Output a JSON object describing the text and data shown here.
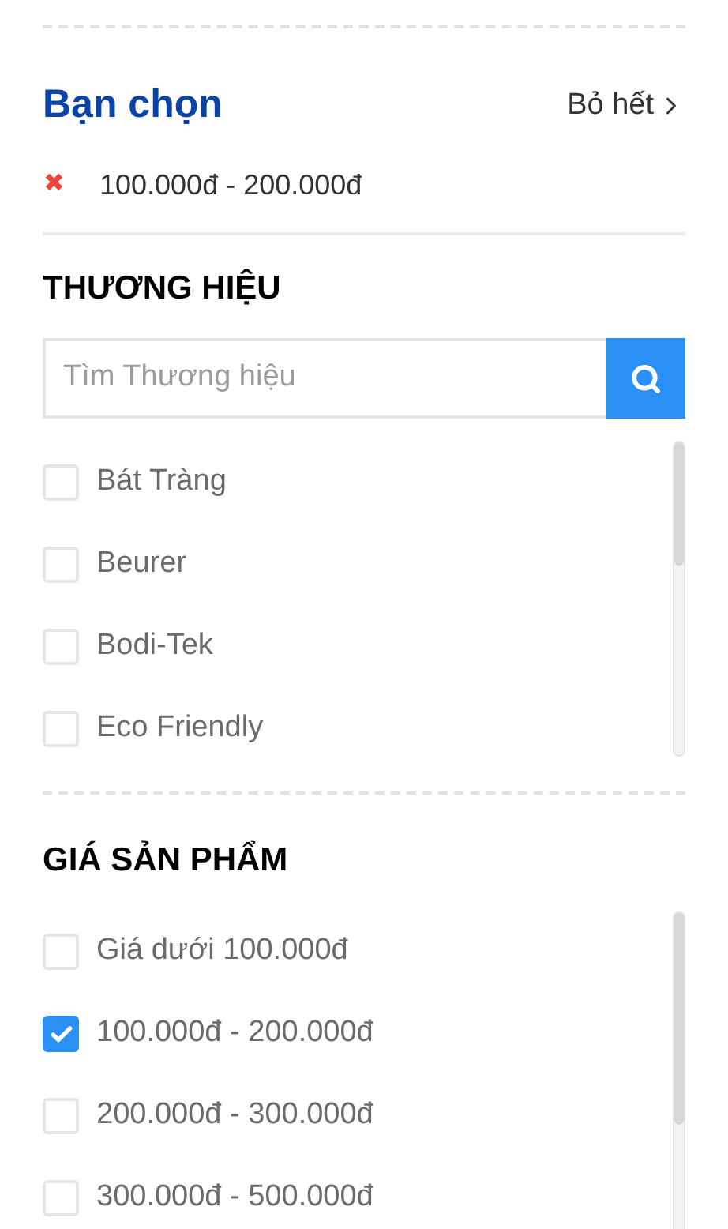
{
  "selected_filters": {
    "title": "Bạn chọn",
    "clear_all": "Bỏ hết",
    "remove_icon": "✖",
    "items": [
      "100.000đ - 200.000đ"
    ]
  },
  "brand": {
    "title": "THƯƠNG HIỆU",
    "search": {
      "placeholder": "Tìm Thương hiệu"
    },
    "options": [
      {
        "label": "Bát Tràng",
        "checked": false
      },
      {
        "label": "Beurer",
        "checked": false
      },
      {
        "label": "Bodi-Tek",
        "checked": false
      },
      {
        "label": "Eco Friendly",
        "checked": false
      }
    ]
  },
  "price": {
    "title": "GIÁ SẢN PHẨM",
    "options": [
      {
        "label": "Giá dưới 100.000đ",
        "checked": false
      },
      {
        "label": "100.000đ - 200.000đ",
        "checked": true
      },
      {
        "label": "200.000đ - 300.000đ",
        "checked": false
      },
      {
        "label": "300.000đ - 500.000đ",
        "checked": false
      }
    ]
  }
}
